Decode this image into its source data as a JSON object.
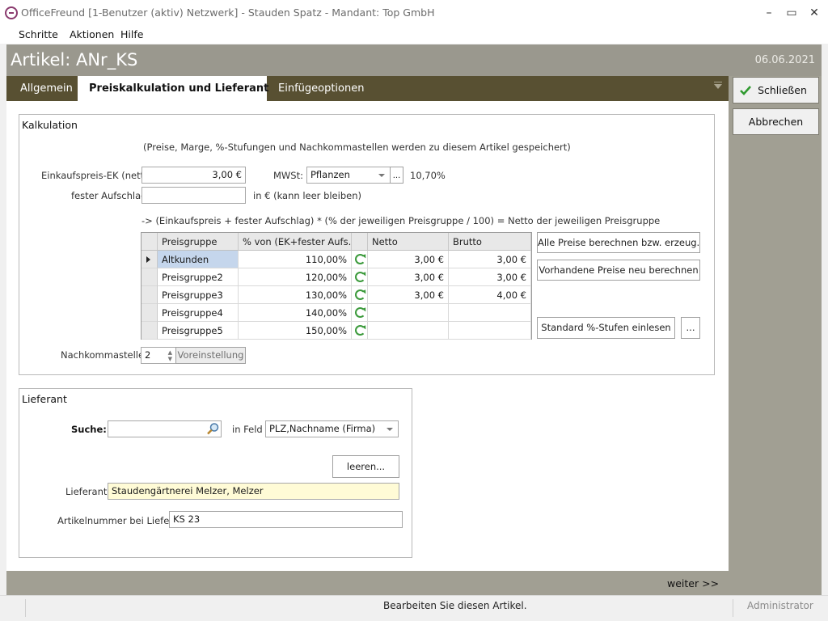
{
  "window": {
    "title": "OfficeFreund [1-Benutzer (aktiv) Netzwerk]  -  Stauden Spatz  -  Mandant: Top GmbH",
    "minimize": "–",
    "maximize": "▭",
    "close": "✕"
  },
  "menu": [
    "Schritte",
    "Aktionen",
    "Hilfe"
  ],
  "header": {
    "title": "Artikel: ANr_KS",
    "date": "06.06.2021"
  },
  "tabs": [
    {
      "label": "Allgemein"
    },
    {
      "label": "Preiskalkulation und Lieferant"
    },
    {
      "label": "Einfügeoptionen"
    }
  ],
  "sidebar": {
    "close_label": "Schließen",
    "cancel_label": "Abbrechen"
  },
  "kalkulation": {
    "title": "Kalkulation",
    "note": "(Preise, Marge, %-Stufungen und Nachkommastellen werden zu diesem Artikel gespeichert)",
    "ek_label": "Einkaufspreis-EK (netto):",
    "ek_value": "3,00 €",
    "mwst_label": "MWSt:",
    "mwst_value": "Pflanzen",
    "mwst_more": "...",
    "mwst_rate": "10,70%",
    "aufschlag_label": "fester Aufschlag:",
    "aufschlag_value": "",
    "aufschlag_hint": "in € (kann leer bleiben)",
    "formula": "-> (Einkaufspreis + fester Aufschlag) * (% der jeweiligen Preisgruppe / 100) = Netto der jeweiligen Preisgruppe",
    "grid": {
      "columns": [
        "Preisgruppe",
        "% von (EK+fester Aufs...",
        "",
        "Netto",
        "Brutto"
      ],
      "rows": [
        {
          "gruppe": "Altkunden",
          "prozent": "110,00%",
          "netto": "3,00 €",
          "brutto": "3,00 €"
        },
        {
          "gruppe": "Preisgruppe2",
          "prozent": "120,00%",
          "netto": "3,00 €",
          "brutto": "3,00 €"
        },
        {
          "gruppe": "Preisgruppe3",
          "prozent": "130,00%",
          "netto": "3,00 €",
          "brutto": "4,00 €"
        },
        {
          "gruppe": "Preisgruppe4",
          "prozent": "140,00%",
          "netto": "",
          "brutto": ""
        },
        {
          "gruppe": "Preisgruppe5",
          "prozent": "150,00%",
          "netto": "",
          "brutto": ""
        }
      ]
    },
    "btn_all_prices": "Alle Preise berechnen bzw. erzeug...",
    "btn_recalc": "Vorhandene Preise neu berechnen",
    "btn_standard": "Standard %-Stufen einlesen",
    "btn_more": "...",
    "decimals_label": "Nachkommastellen:",
    "decimals_value": "2",
    "btn_default": "Voreinstellung"
  },
  "lieferant": {
    "title": "Lieferant",
    "search_label": "Suche:",
    "search_value": "",
    "field_label": "in Feld",
    "field_value": "PLZ,Nachname (Firma)",
    "btn_clear": "leeren...",
    "supplier_label": "Lieferant:",
    "supplier_value": "Staudengärtnerei Melzer, Melzer",
    "artnr_label": "Artikelnummer bei Lieferant:",
    "artnr_value": "KS 23"
  },
  "nav": {
    "next": "weiter >>"
  },
  "status": {
    "message": "Bearbeiten Sie diesen Artikel.",
    "user": "Administrator"
  },
  "colors": {
    "header": "#9a988e",
    "tabstrip": "#585032",
    "supplier_highlight": "#fffbd6",
    "selected_cell": "#c5d6ec"
  }
}
